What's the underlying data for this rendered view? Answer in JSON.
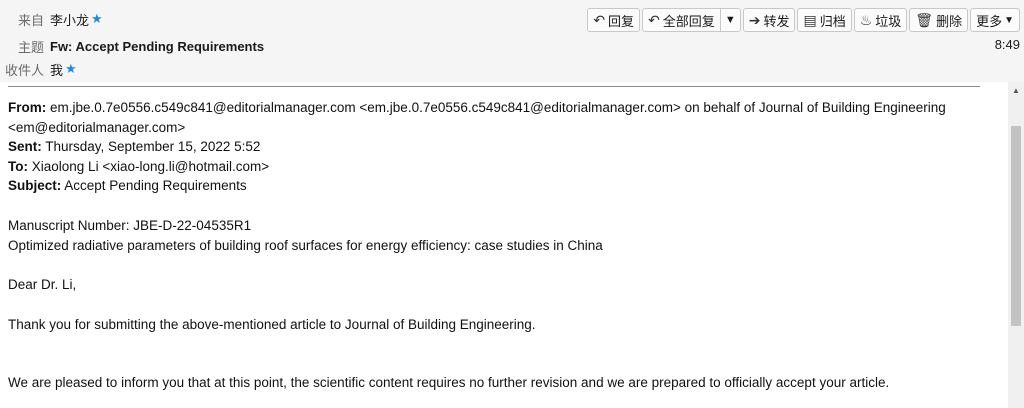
{
  "header": {
    "from_label": "来自",
    "from_name": "李小龙",
    "subject_label": "主题",
    "subject": "Fw: Accept Pending Requirements",
    "to_label": "收件人",
    "to_name": "我",
    "time": "8:49",
    "star_icon": "star-icon"
  },
  "toolbar": {
    "reply": "回复",
    "reply_all": "全部回复",
    "forward": "转发",
    "archive": "归档",
    "junk": "垃圾",
    "delete": "删除",
    "more": "更多"
  },
  "body": {
    "from_label": "From:",
    "from_value": "em.jbe.0.7e0556.c549c841@editorialmanager.com <em.jbe.0.7e0556.c549c841@editorialmanager.com> on behalf of Journal of Building Engineering <em@editorialmanager.com>",
    "sent_label": "Sent:",
    "sent_value": "Thursday, September 15, 2022 5:52",
    "to_label": "To:",
    "to_value": "Xiaolong Li <xiao-long.li@hotmail.com>",
    "subject_label": "Subject:",
    "subject_value": "Accept Pending Requirements",
    "manuscript": "Manuscript Number: JBE-D-22-04535R1",
    "title": "Optimized radiative parameters of building roof surfaces for energy efficiency: case studies in China",
    "greeting": "Dear Dr. Li,",
    "para1": "Thank you for submitting the above-mentioned article to Journal of Building Engineering.",
    "para2": "We are pleased to inform you that at this point, the scientific content requires no further revision and we are prepared to officially accept your article."
  }
}
